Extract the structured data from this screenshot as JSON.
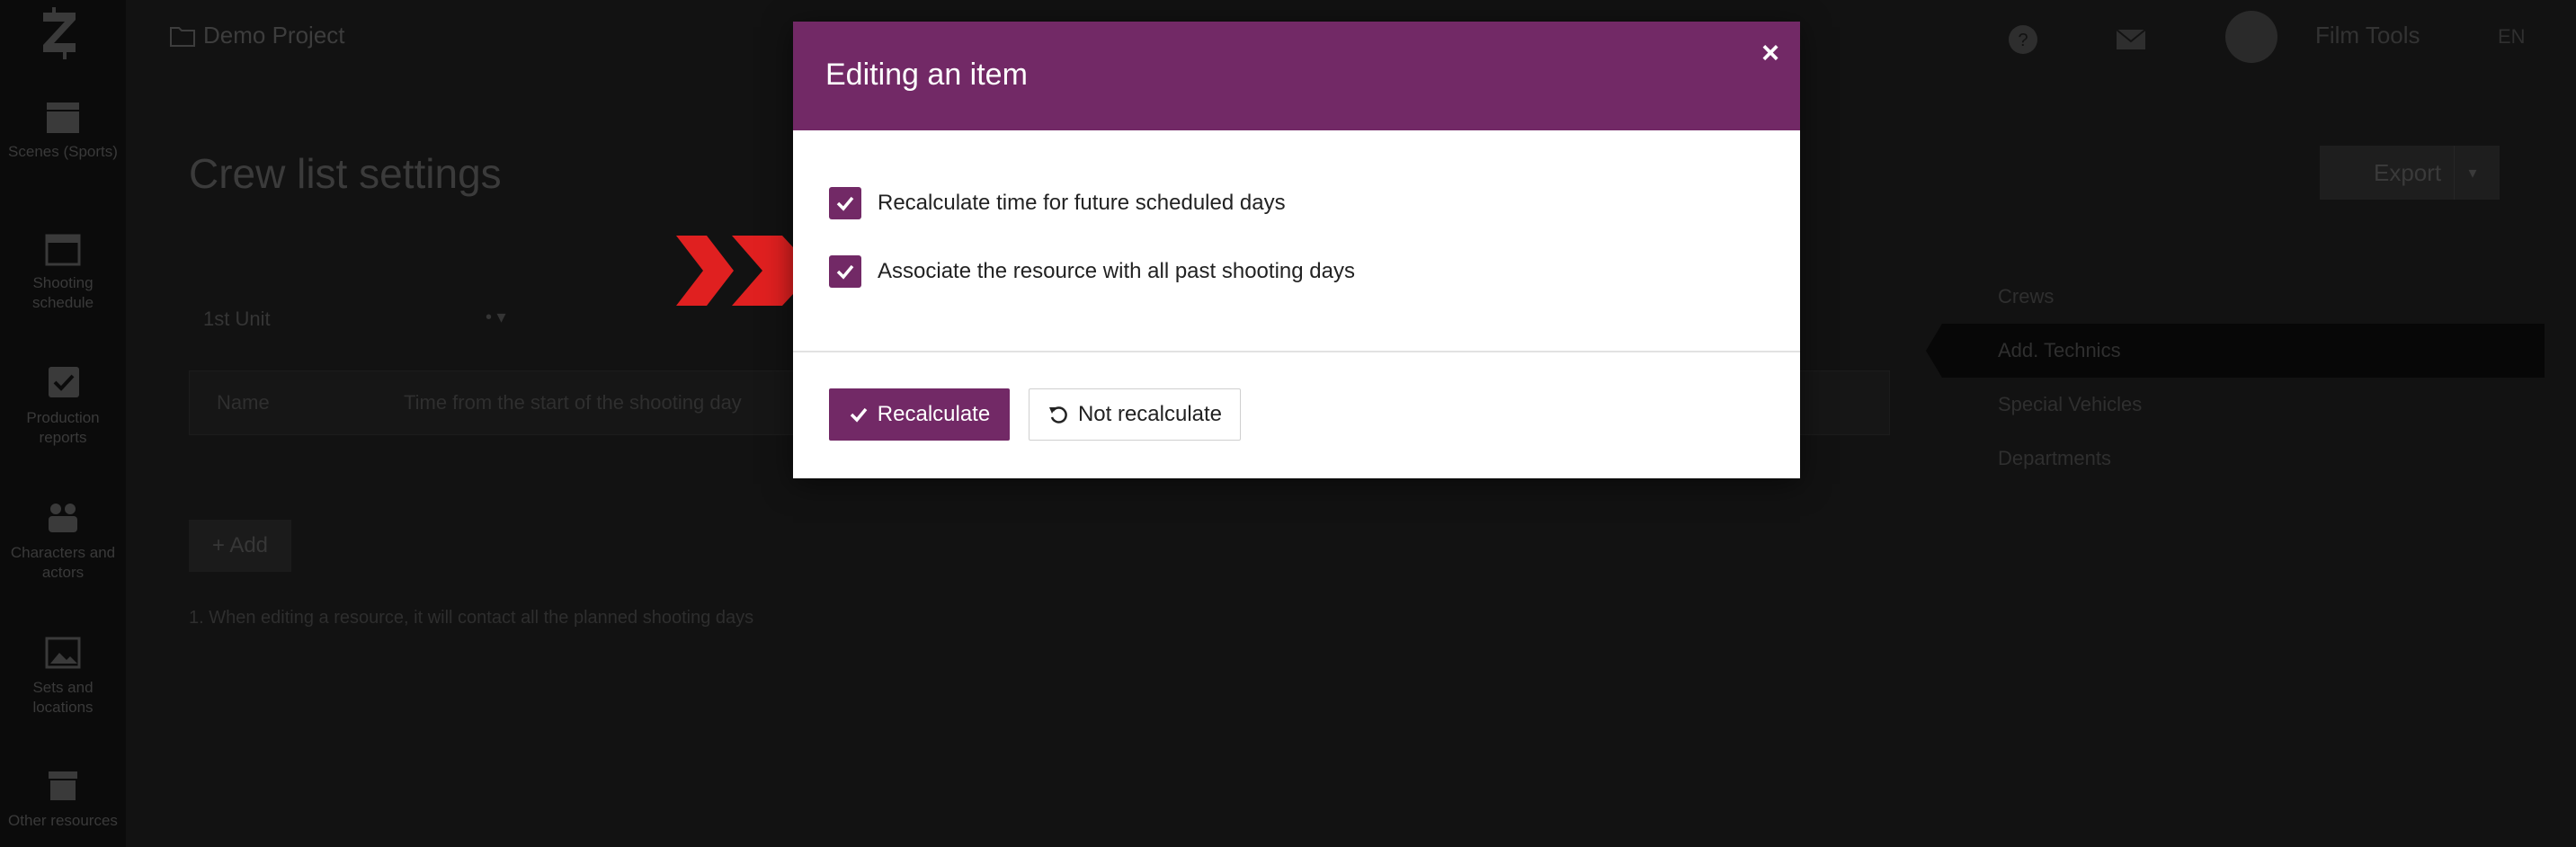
{
  "sidebar": {
    "items": [
      {
        "label": "Scenes (Sports)",
        "icon": "clapperboard-icon"
      },
      {
        "label": "Shooting schedule",
        "icon": "calendar-icon"
      },
      {
        "label": "Production reports",
        "icon": "checkbox-icon"
      },
      {
        "label": "Characters and actors",
        "icon": "people-icon"
      },
      {
        "label": "Sets and locations",
        "icon": "image-icon"
      },
      {
        "label": "Other resources",
        "icon": "box-icon"
      }
    ]
  },
  "header": {
    "project": "Demo Project",
    "user_name": "Film Tools",
    "language": "EN"
  },
  "page": {
    "title": "Crew list settings",
    "export_label": "Export",
    "unit_selected": "1st Unit",
    "table": {
      "col_name": "Name",
      "col_time": "Time from the start of the shooting day"
    },
    "add_label": "+ Add",
    "footnote": "1. When editing a resource, it will contact all the planned shooting days"
  },
  "right_tabs": [
    {
      "label": "Crews",
      "active": false
    },
    {
      "label": "Add. Technics",
      "active": true
    },
    {
      "label": "Special Vehicles",
      "active": false
    },
    {
      "label": "Departments",
      "active": false
    }
  ],
  "modal": {
    "title": "Editing an item",
    "close_symbol": "×",
    "options": [
      {
        "label": "Recalculate time for future scheduled days",
        "checked": true
      },
      {
        "label": "Associate the resource with all past shooting days",
        "checked": true
      }
    ],
    "recalculate_label": "Recalculate",
    "not_recalculate_label": "Not recalculate"
  },
  "colors": {
    "accent": "#722966",
    "pointer": "#e02020",
    "overlay_bg": "#121212"
  }
}
